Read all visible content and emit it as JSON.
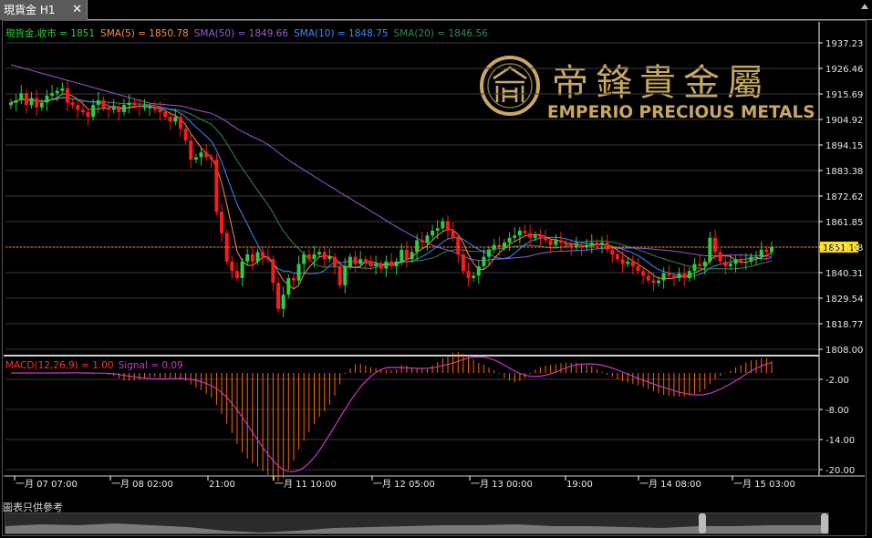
{
  "tab": {
    "label": "現貨金 H1",
    "close": "✕"
  },
  "footnote": "圖表只供參考",
  "colors": {
    "up": "#2ecc40",
    "down": "#ff1a1a",
    "grid": "#3a3a3a",
    "axis": "#ffffff",
    "sma5": "#ff8c42",
    "sma50": "#9b59d6",
    "sma10": "#3b8bff",
    "sma20": "#2e8b57",
    "macd": "#ff6a00",
    "signal": "#cc33cc",
    "price_line": "#ff8c00",
    "gold": "#c8a860"
  },
  "logo": {
    "chinese": "帝鋒貴金屬",
    "english": "EMPERIO PRECIOUS METALS"
  },
  "chart_data": [
    {
      "type": "line",
      "panel": "price",
      "legend": [
        {
          "text": "現貨金,收市 = 1851",
          "color": "#2ecc40"
        },
        {
          "text": "SMA(5) = 1850.78",
          "color": "#ff8c42"
        },
        {
          "text": "SMA(50) = 1849.66",
          "color": "#9b59d6"
        },
        {
          "text": "SMA(10) = 1848.75",
          "color": "#3b8bff"
        },
        {
          "text": "SMA(20) = 1846.56",
          "color": "#2e8b57"
        }
      ],
      "ylim": [
        1808.0,
        1937.23
      ],
      "y_ticks": [
        "1937.23",
        "1926.46",
        "1915.69",
        "1904.92",
        "1894.15",
        "1883.38",
        "1872.62",
        "1861.85",
        "1851.08",
        "1840.31",
        "1829.54",
        "1818.77",
        "1808.00"
      ],
      "current_price": "1851.10",
      "x_ticks": [
        "一月 07 07:00",
        "一月 08 02:00",
        "21:00",
        "一月 11 10:00",
        "一月 12 05:00",
        "一月 13 00:00",
        "19:00",
        "一月 14 08:00",
        "一月 15 03:00"
      ],
      "close": [
        1912,
        1913,
        1916,
        1911,
        1914,
        1910,
        1912,
        1915,
        1916,
        1917,
        1918,
        1912,
        1911,
        1909,
        1908,
        1906,
        1911,
        1913,
        1910,
        1909,
        1910,
        1908,
        1911,
        1912,
        1911,
        1910,
        1910,
        1910,
        1909,
        1908,
        1906,
        1904,
        1906,
        1901,
        1896,
        1888,
        1889,
        1891,
        1889,
        1888,
        1866,
        1857,
        1845,
        1841,
        1838,
        1845,
        1848,
        1845,
        1849,
        1847,
        1846,
        1836,
        1825,
        1831,
        1838,
        1837,
        1844,
        1848,
        1846,
        1848,
        1849,
        1846,
        1847,
        1843,
        1835,
        1843,
        1847,
        1844,
        1846,
        1845,
        1843,
        1844,
        1842,
        1845,
        1843,
        1845,
        1850,
        1846,
        1849,
        1854,
        1853,
        1856,
        1858,
        1859,
        1862,
        1858,
        1855,
        1848,
        1841,
        1838,
        1839,
        1843,
        1847,
        1850,
        1852,
        1851,
        1853,
        1855,
        1856,
        1858,
        1857,
        1855,
        1856,
        1855,
        1854,
        1852,
        1854,
        1853,
        1852,
        1851,
        1852,
        1851,
        1852,
        1853,
        1852,
        1853,
        1850,
        1848,
        1846,
        1844,
        1845,
        1843,
        1841,
        1839,
        1837,
        1836,
        1837,
        1840,
        1839,
        1838,
        1840,
        1838,
        1841,
        1844,
        1843,
        1845,
        1855,
        1849,
        1845,
        1843,
        1844,
        1846,
        1845,
        1845,
        1847,
        1847,
        1850,
        1849,
        1851
      ]
    },
    {
      "type": "bar",
      "panel": "macd",
      "legend": [
        {
          "text": "MACD(12,26,9) = 1.00",
          "color": "#ff3030"
        },
        {
          "text": "Signal = 0.09",
          "color": "#cc33cc"
        }
      ],
      "y_ticks": [
        "-2.00",
        "-8.00",
        "-14.00",
        "-20.00"
      ]
    }
  ]
}
